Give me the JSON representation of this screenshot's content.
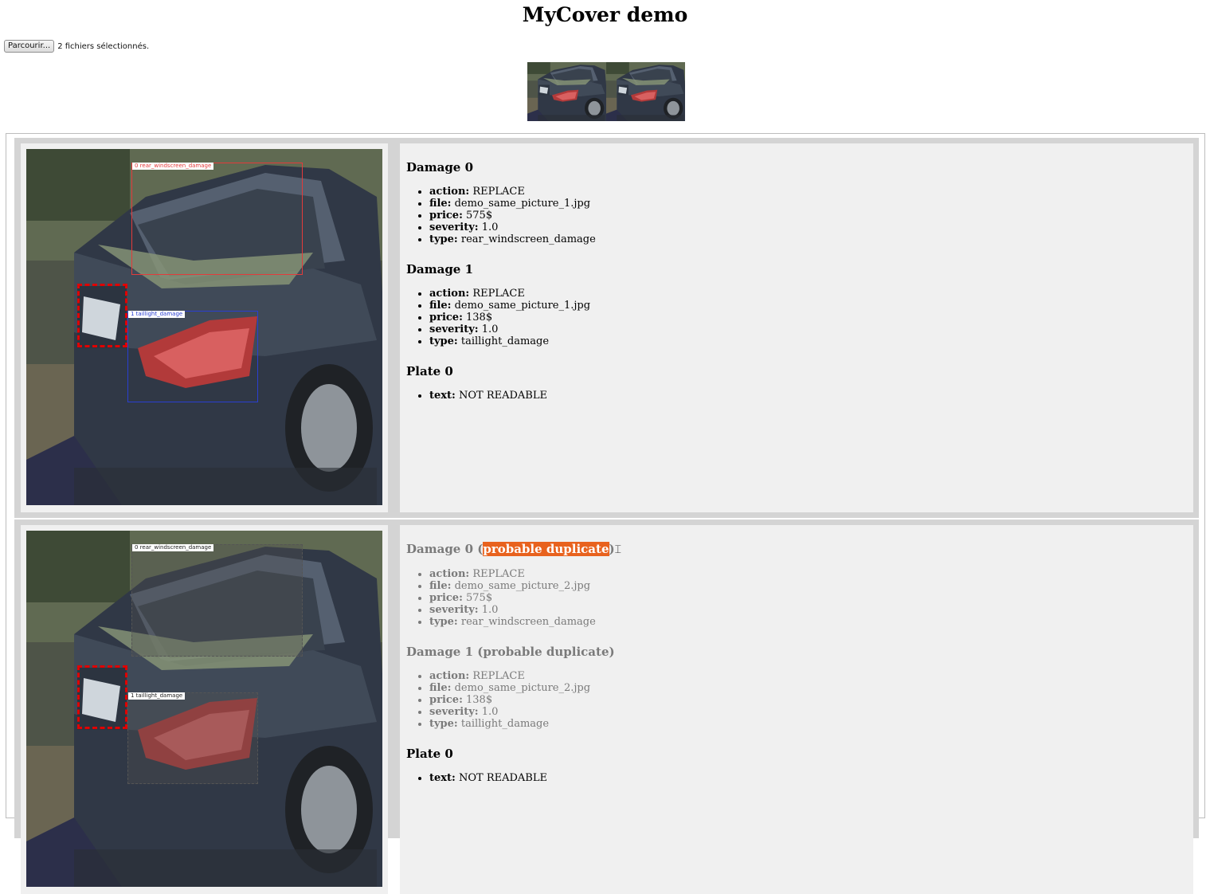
{
  "page": {
    "title": "MyCover demo"
  },
  "upload": {
    "browse_label": "Parcourir...",
    "status": "2 fichiers sélectionnés."
  },
  "thumbnails": [
    {
      "icon": "car-photo-thumbnail"
    },
    {
      "icon": "car-photo-thumbnail"
    }
  ],
  "colors": {
    "damage_box_1": "#e33b3b",
    "damage_box_2": "#2a3fd1",
    "plate_box": "#e00000",
    "highlight": "#e8621e",
    "duplicate_text": "#7a7a7a"
  },
  "results": [
    {
      "image": {
        "box_labels": [
          "0 rear_windscreen_damage",
          "1 taillight_damage"
        ]
      },
      "damages": [
        {
          "heading": "Damage 0",
          "fields": [
            {
              "key": "action:",
              "value": "REPLACE"
            },
            {
              "key": "file:",
              "value": "demo_same_picture_1.jpg"
            },
            {
              "key": "price:",
              "value": "575$"
            },
            {
              "key": "severity:",
              "value": "1.0"
            },
            {
              "key": "type:",
              "value": "rear_windscreen_damage"
            }
          ]
        },
        {
          "heading": "Damage 1",
          "fields": [
            {
              "key": "action:",
              "value": "REPLACE"
            },
            {
              "key": "file:",
              "value": "demo_same_picture_1.jpg"
            },
            {
              "key": "price:",
              "value": "138$"
            },
            {
              "key": "severity:",
              "value": "1.0"
            },
            {
              "key": "type:",
              "value": "taillight_damage"
            }
          ]
        }
      ],
      "plate": {
        "heading": "Plate 0",
        "fields": [
          {
            "key": "text:",
            "value": "NOT READABLE"
          }
        ]
      }
    },
    {
      "image": {
        "box_labels": [
          "0 rear_windscreen_damage",
          "1 taillight_damage"
        ]
      },
      "damages": [
        {
          "heading_prefix": "Damage 0 (",
          "heading_highlight": "probable duplicate",
          "heading_suffix": ")",
          "fields": [
            {
              "key": "action:",
              "value": "REPLACE"
            },
            {
              "key": "file:",
              "value": "demo_same_picture_2.jpg"
            },
            {
              "key": "price:",
              "value": "575$"
            },
            {
              "key": "severity:",
              "value": "1.0"
            },
            {
              "key": "type:",
              "value": "rear_windscreen_damage"
            }
          ]
        },
        {
          "heading": "Damage 1 (probable duplicate)",
          "fields": [
            {
              "key": "action:",
              "value": "REPLACE"
            },
            {
              "key": "file:",
              "value": "demo_same_picture_2.jpg"
            },
            {
              "key": "price:",
              "value": "138$"
            },
            {
              "key": "severity:",
              "value": "1.0"
            },
            {
              "key": "type:",
              "value": "taillight_damage"
            }
          ]
        }
      ],
      "plate": {
        "heading": "Plate 0",
        "fields": [
          {
            "key": "text:",
            "value": "NOT READABLE"
          }
        ]
      }
    }
  ]
}
